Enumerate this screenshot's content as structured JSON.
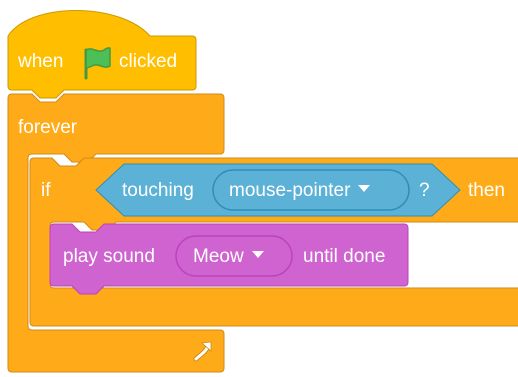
{
  "colors": {
    "events": "#FFBF00",
    "events_border": "#CC9900",
    "control": "#FFAB19",
    "control_border": "#CF8B17",
    "sensing": "#5CB1D6",
    "sensing_border": "#2E8EB8",
    "sound": "#CF63CF",
    "sound_border": "#BD42BD",
    "flag": "#4CBF56",
    "flag_border": "#45993D"
  },
  "hat_block": {
    "when_label": "when",
    "flag_icon": "green-flag-icon",
    "clicked_label": "clicked"
  },
  "forever_block": {
    "label": "forever",
    "loop_icon": "loop-arrow-icon"
  },
  "if_block": {
    "if_label": "if",
    "then_label": "then"
  },
  "touching_block": {
    "label": "touching",
    "menu_value": "mouse-pointer",
    "question_mark": "?"
  },
  "play_sound_block": {
    "label": "play sound",
    "menu_value": "Meow",
    "suffix_label": "until done"
  }
}
